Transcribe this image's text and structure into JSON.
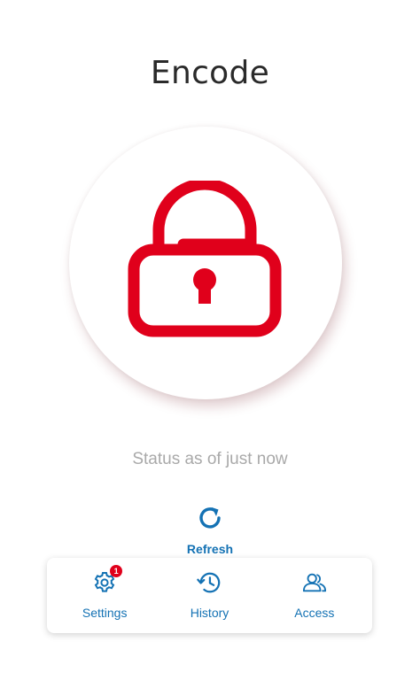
{
  "screen": {
    "title": "Encode",
    "status_text": "Status as of just now",
    "lock_state_icon": "unlocked-padlock-icon",
    "accent_color": "#e0001b",
    "link_color": "#1472b4"
  },
  "refresh": {
    "label": "Refresh",
    "icon": "refresh-icon"
  },
  "bottom_nav": {
    "items": [
      {
        "label": "Settings",
        "icon": "gear-icon",
        "badge": "1"
      },
      {
        "label": "History",
        "icon": "history-icon"
      },
      {
        "label": "Access",
        "icon": "users-icon"
      }
    ]
  }
}
